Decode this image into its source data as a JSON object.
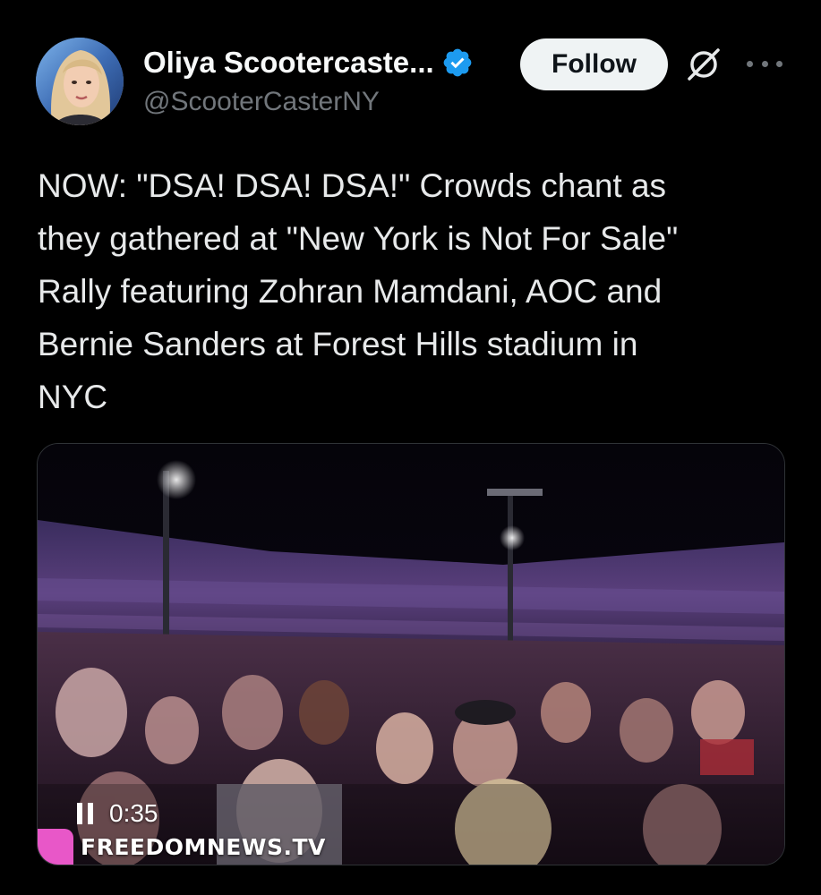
{
  "author": {
    "display_name": "Oliya Scootercaste...",
    "handle": "@ScooterCasterNY",
    "verified_icon": "verified-badge-icon",
    "verified_color": "#1d9bf0"
  },
  "actions": {
    "follow_label": "Follow",
    "grok_icon": "grok-icon",
    "more_icon": "more-options-icon"
  },
  "tweet": {
    "text": "NOW: \"DSA! DSA! DSA!\" Crowds chant as\nthey gathered at \"New York is Not For Sale\"\nRally featuring Zohran Mamdani, AOC and\nBernie Sanders at Forest Hills stadium in\nNYC"
  },
  "media": {
    "type": "video",
    "state": "playing",
    "time": "0:35",
    "watermark": "FREEDOMNEWS.TV",
    "pause_icon": "pause-icon"
  },
  "colors": {
    "background": "#000000",
    "text": "#e7e9ea",
    "secondary": "#71767b",
    "follow_bg": "#eff3f4"
  }
}
